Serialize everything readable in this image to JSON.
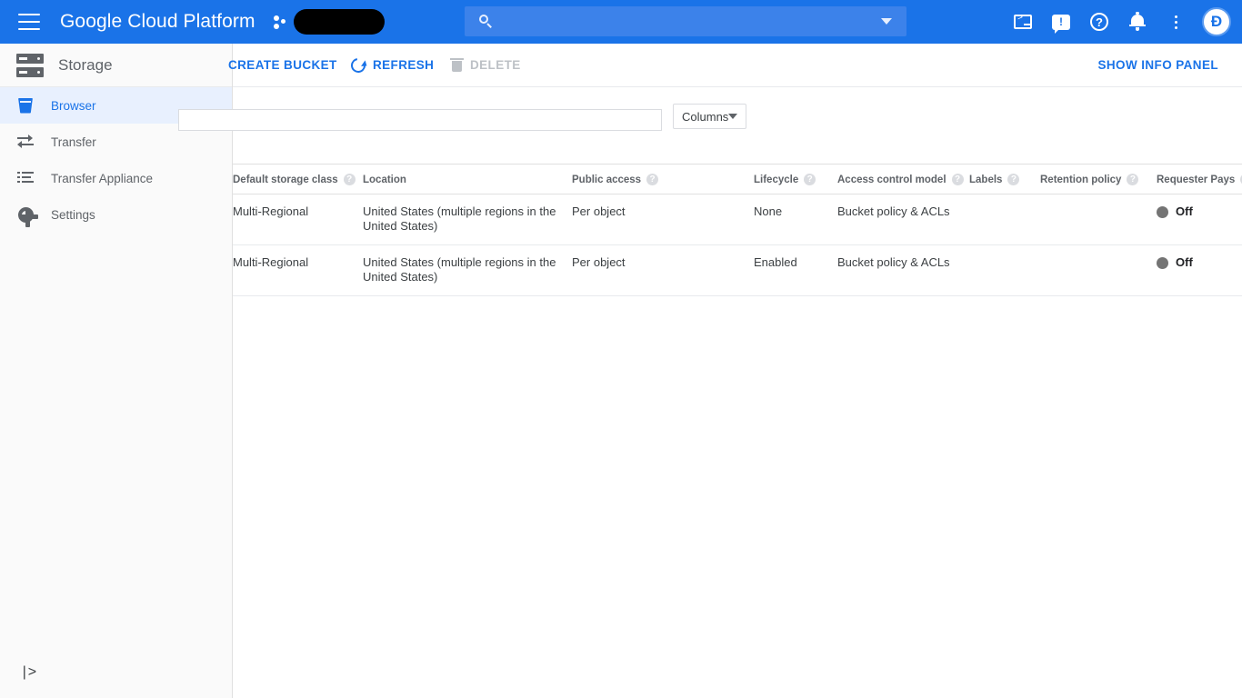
{
  "header": {
    "menu_icon": "hamburger-icon",
    "title": "Google Cloud Platform",
    "project_logo_icon": "project-dots-icon",
    "project_name": "",
    "search": {
      "value": "",
      "placeholder": "",
      "icon": "search-icon",
      "caret_icon": "chevron-down-icon"
    },
    "icons": [
      {
        "name": "cloud-shell-icon",
        "label": ">_"
      },
      {
        "name": "feedback-icon",
        "label": "!"
      },
      {
        "name": "help-icon",
        "label": "?"
      },
      {
        "name": "notifications-icon",
        "label": "bell"
      },
      {
        "name": "more-options-icon",
        "label": "⋮"
      }
    ],
    "avatar_initial": "Ɖ",
    "brand_color": "#1a73e8"
  },
  "sidebar": {
    "product_icon": "storage-icon",
    "product_title": "Storage",
    "items": [
      {
        "label": "Browser",
        "icon": "bucket-icon",
        "active": true
      },
      {
        "label": "Transfer",
        "icon": "transfer-arrows-icon",
        "active": false
      },
      {
        "label": "Transfer Appliance",
        "icon": "appliance-list-icon",
        "active": false
      },
      {
        "label": "Settings",
        "icon": "gear-icon",
        "active": false
      }
    ],
    "expand_icon": "|>",
    "active_color": "#1a73e8",
    "active_bg": "#e8f0fe"
  },
  "toolbar": {
    "create_bucket_label": "CREATE BUCKET",
    "refresh_label": "REFRESH",
    "refresh_icon": "refresh-icon",
    "delete_label": "DELETE",
    "delete_icon": "trash-icon",
    "delete_disabled": true,
    "show_info_panel_label": "SHOW INFO PANEL"
  },
  "filters": {
    "filter_value": "",
    "filter_placeholder": "",
    "columns_label": "Columns",
    "columns_caret_icon": "chevron-down-icon"
  },
  "table": {
    "columns": [
      {
        "label": "Default storage class",
        "help": true
      },
      {
        "label": "Location",
        "help": false
      },
      {
        "label": "Public access",
        "help": true
      },
      {
        "label": "Lifecycle",
        "help": true
      },
      {
        "label": "Access control model",
        "help": true
      },
      {
        "label": "Labels",
        "help": true
      },
      {
        "label": "Retention policy",
        "help": true
      },
      {
        "label": "Requester Pays",
        "help": true
      }
    ],
    "help_glyph": "?",
    "rows": [
      {
        "storage_class": "Multi-Regional",
        "location": "United States (multiple regions in the United States)",
        "public_access": "Per object",
        "lifecycle": "None",
        "access_control_model": "Bucket policy & ACLs",
        "labels": "",
        "retention_policy": "",
        "requester_pays": "Off",
        "requester_pays_dot_color": "#747474",
        "menu_icon": "kebab-menu-icon"
      },
      {
        "storage_class": "Multi-Regional",
        "location": "United States (multiple regions in the United States)",
        "public_access": "Per object",
        "lifecycle": "Enabled",
        "access_control_model": "Bucket policy & ACLs",
        "labels": "",
        "retention_policy": "",
        "requester_pays": "Off",
        "requester_pays_dot_color": "#747474",
        "menu_icon": "kebab-menu-icon"
      }
    ]
  }
}
